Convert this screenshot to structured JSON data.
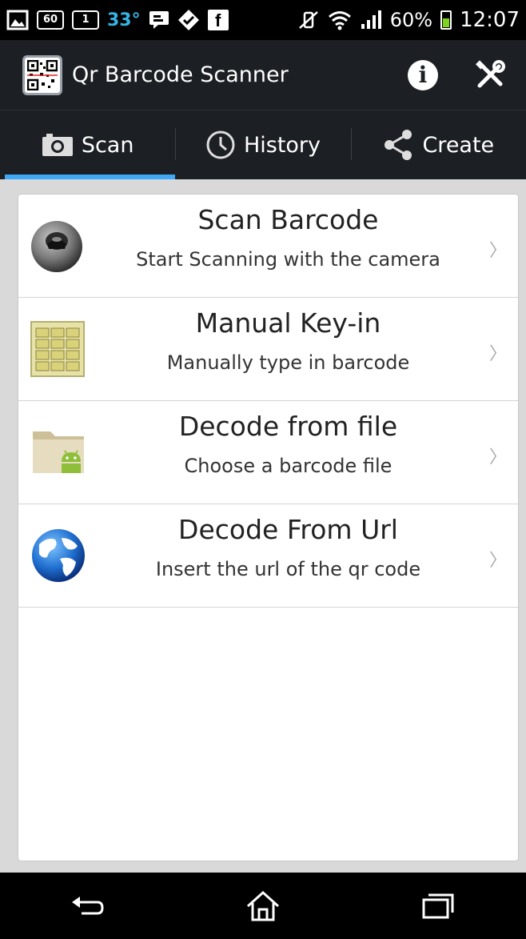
{
  "status_bar": {
    "left_badges": [
      "60",
      "1"
    ],
    "temperature": "33°",
    "facebook": "f",
    "battery": "60%",
    "battery_level": 0.6,
    "clock": "12:07"
  },
  "action_bar": {
    "title": "Qr Barcode Scanner",
    "icons": [
      "qr-code-icon",
      "info-icon",
      "tools-icon"
    ]
  },
  "tabs": [
    {
      "label": "Scan",
      "icon": "camera-icon",
      "active": true
    },
    {
      "label": "History",
      "icon": "clock-icon",
      "active": false
    },
    {
      "label": "Create",
      "icon": "share-icon",
      "active": false
    }
  ],
  "list": [
    {
      "title": "Scan Barcode",
      "subtitle": "Start Scanning with the camera",
      "icon": "camera-lens-icon"
    },
    {
      "title": "Manual Key-in",
      "subtitle": "Manually type in barcode",
      "icon": "keypad-icon"
    },
    {
      "title": "Decode from file",
      "subtitle": "Choose a barcode file",
      "icon": "android-folder-icon"
    },
    {
      "title": "Decode From Url",
      "subtitle": "Insert the url of the qr code",
      "icon": "globe-icon"
    }
  ],
  "nav_bar": {
    "icons": [
      "back-icon",
      "home-icon",
      "recent-apps-icon"
    ]
  },
  "colors": {
    "accent": "#3fa9f5",
    "action_bar_bg": "#1c1f24",
    "temperature": "#35b5e5"
  }
}
